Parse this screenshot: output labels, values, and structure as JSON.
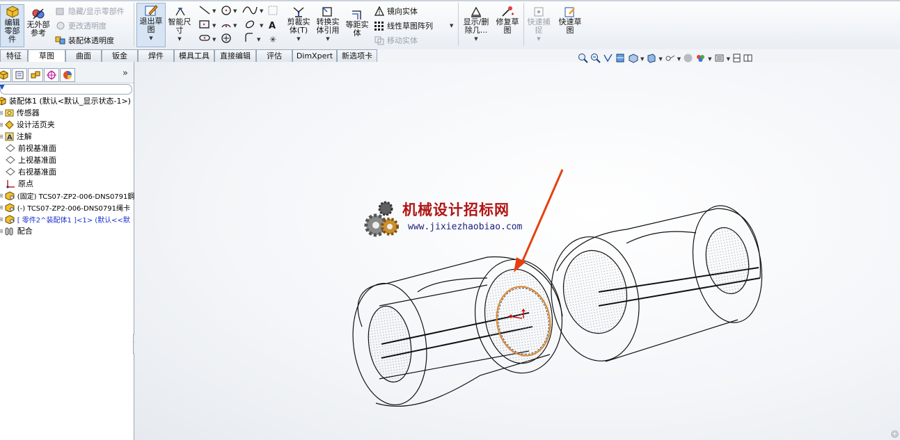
{
  "ribbon": {
    "edit_component": "编辑零部件",
    "no_external_refs": "无外部参考",
    "hide_show_components": "隐藏/显示零部件",
    "change_transparency": "更改透明度",
    "assembly_transparency": "装配体透明度",
    "exit_sketch": "退出草图",
    "smart_dimension": "智能尺寸",
    "trim_entities": "剪裁实体(T)",
    "convert_entities": "转换实体引用",
    "offset_entities": "等距实体",
    "mirror_entities": "镜向实体",
    "linear_pattern": "线性草图阵列",
    "move_entities": "移动实体",
    "display_delete_relations": "显示/删除几...",
    "repair_sketch": "修复草图",
    "quick_snaps": "快速捕捉",
    "rapid_sketch": "快速草图"
  },
  "tabs": [
    "特征",
    "草图",
    "曲面",
    "钣金",
    "焊件",
    "模具工具",
    "直接编辑",
    "评估",
    "DimXpert",
    "新选项卡"
  ],
  "active_tab": "草图",
  "tree": {
    "root": "装配体1 (默认<默认_显示状态-1>)",
    "items": [
      {
        "label": "传感器",
        "icon": "sensor-icon"
      },
      {
        "label": "设计活页夹",
        "icon": "design-binder-icon"
      },
      {
        "label": "注解",
        "icon": "annotation-icon"
      },
      {
        "label": "前视基准面",
        "icon": "plane-icon"
      },
      {
        "label": "上视基准面",
        "icon": "plane-icon"
      },
      {
        "label": "右视基准面",
        "icon": "plane-icon"
      },
      {
        "label": "原点",
        "icon": "origin-icon"
      },
      {
        "label": "(固定) TCS07-ZP2-006-DNS0791鋼",
        "icon": "part-icon"
      },
      {
        "label": "(-) TCS07-ZP2-006-DNS0791绳卡",
        "icon": "part-icon"
      },
      {
        "label": "[ 零件2^装配体1 ]<1> (默认<<默",
        "icon": "part-icon"
      },
      {
        "label": "配合",
        "icon": "mates-icon"
      }
    ]
  },
  "watermark": {
    "title": "机械设计招标网",
    "url": "www.jixiezhaobiao.com"
  },
  "colors": {
    "accent": "#e64010",
    "sketch_circle": "#d9862e",
    "watermark_title": "#b01414"
  }
}
